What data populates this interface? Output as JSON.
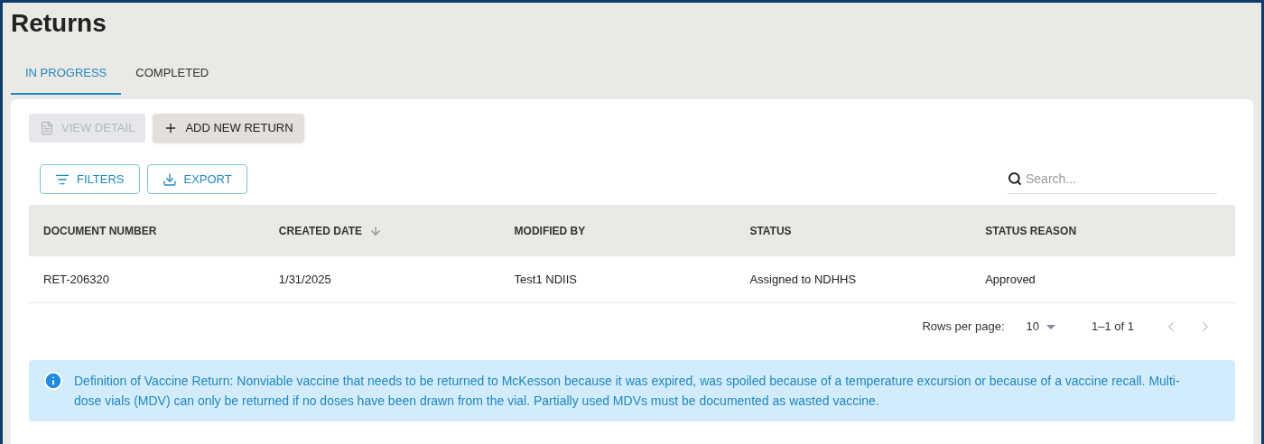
{
  "page": {
    "title": "Returns"
  },
  "tabs": [
    {
      "label": "IN PROGRESS",
      "selected": true
    },
    {
      "label": "COMPLETED",
      "selected": false
    }
  ],
  "actions": [
    {
      "label": "VIEW DETAIL",
      "kind": "detail",
      "disabled": true
    },
    {
      "label": "ADD NEW RETURN",
      "kind": "add",
      "disabled": false
    }
  ],
  "toolbar": [
    {
      "label": "FILTERS",
      "kind": "filter"
    },
    {
      "label": "EXPORT",
      "kind": "export"
    }
  ],
  "search": {
    "placeholder": "Search..."
  },
  "table": {
    "columns": [
      {
        "label": "DOCUMENT NUMBER",
        "sorted": false
      },
      {
        "label": "CREATED DATE",
        "sorted": true
      },
      {
        "label": "MODIFIED BY",
        "sorted": false
      },
      {
        "label": "STATUS",
        "sorted": false
      },
      {
        "label": "STATUS REASON",
        "sorted": false
      }
    ],
    "rows": [
      [
        "RET-206320",
        "1/31/2025",
        "Test1 NDIIS",
        "Assigned to NDHHS",
        "Approved"
      ]
    ]
  },
  "pagination": {
    "rows_per_page_label": "Rows per page:",
    "rows_per_page": "10",
    "range": "1–1 of 1"
  },
  "info": {
    "text": "Definition of Vaccine Return: Nonviable vaccine that needs to be returned to McKesson because it was expired, was spoiled because of a temperature excursion or because of a vaccine recall. Multi-dose vials (MDV) can only be returned if no doses have been drawn from the vial. Partially used MDVs must be documented as wasted vaccine."
  }
}
